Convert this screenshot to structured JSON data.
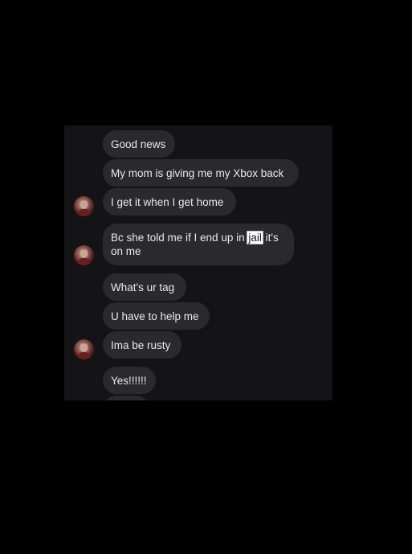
{
  "conversation": {
    "messages": [
      {
        "text": "Good news"
      },
      {
        "text": "My mom is giving me my Xbox back"
      },
      {
        "text": "I get it when I get home"
      },
      {
        "text_before": "Bc she told me if I end up in ",
        "highlight": "jail",
        "text_after": " it's on me"
      },
      {
        "text": "What's ur tag"
      },
      {
        "text": "U have to help me"
      },
      {
        "text": "Ima be rusty"
      },
      {
        "text": "Yes!!!!!!"
      }
    ]
  },
  "colors": {
    "background": "#000000",
    "chat_background": "#141416",
    "bubble": "#2a2a2d",
    "text": "#e9e9ea"
  },
  "icons": [
    "profile-avatar"
  ]
}
